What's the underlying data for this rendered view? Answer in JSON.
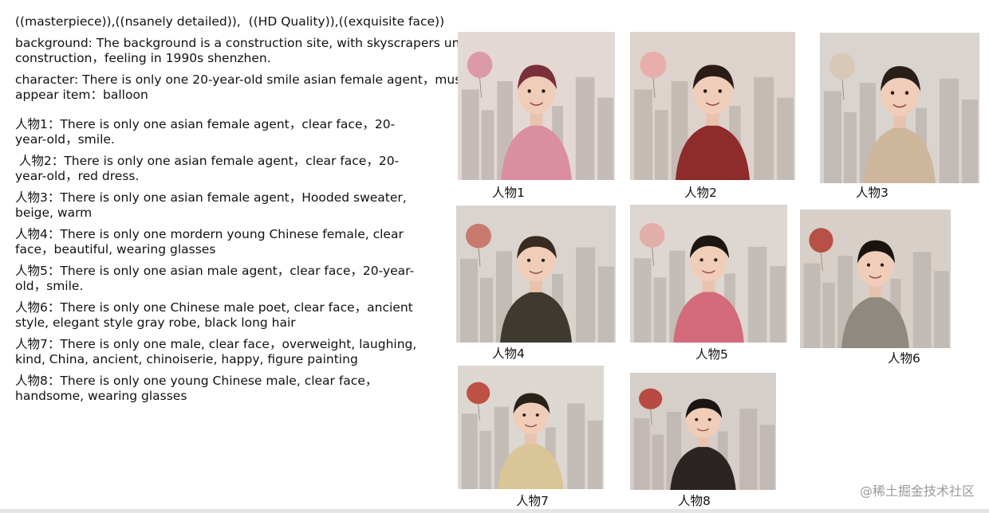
{
  "prompt_text": {
    "quality_line": "((masterpiece)),((nsanely detailed)),  ((HD Quality)),((exquisite face))",
    "background_lines": [
      "background: The background is a construction site, with skyscrapers under",
      "construction，feeling in 1990s shenzhen."
    ],
    "character_lines": [
      "character: There is only one 20-year-old smile asian female agent，must",
      "appear item：balloon"
    ],
    "character_list": [
      {
        "lines": [
          "人物1：There is only one asian female agent，clear face，20-",
          "year-old，smile."
        ]
      },
      {
        "lines": [
          " 人物2：There is only one asian female agent，clear face，20-",
          "year-old，red dress."
        ]
      },
      {
        "lines": [
          "人物3：There is only one asian female agent，Hooded sweater,",
          "beige, warm"
        ]
      },
      {
        "lines": [
          "人物4：There is only one mordern young Chinese female, clear",
          "face，beautiful, wearing glasses"
        ]
      },
      {
        "lines": [
          "人物5：There is only one asian male agent，clear face，20-year-",
          "old，smile."
        ]
      },
      {
        "lines": [
          "人物6：There is only one Chinese male poet, clear face，ancient",
          "style, elegant style gray robe, black long hair"
        ]
      },
      {
        "lines": [
          "人物7：There is only one male, clear face，overweight, laughing,",
          "kind, China, ancient, chinoiserie, happy, figure painting"
        ]
      },
      {
        "lines": [
          "人物8：There is only one young Chinese male, clear face，",
          "handsome, wearing glasses"
        ]
      }
    ]
  },
  "gallery": [
    {
      "caption": "人物1",
      "icon": "portrait-smiling-woman-balloon",
      "colors": {
        "bg": "#e4d8d4",
        "accent": "#d98fa0",
        "hair": "#7a2f3a",
        "cloth": "#d98fa0"
      }
    },
    {
      "caption": "人物2",
      "icon": "portrait-woman-red-dress",
      "colors": {
        "bg": "#ddd3cc",
        "accent": "#e9a7a6",
        "hair": "#2b1c18",
        "cloth": "#8e2b2b"
      }
    },
    {
      "caption": "人物3",
      "icon": "portrait-woman-hooded-sweater",
      "colors": {
        "bg": "#d9d4cf",
        "accent": "#d9c6b1",
        "hair": "#2a1e18",
        "cloth": "#cdb69c"
      }
    },
    {
      "caption": "人物4",
      "icon": "portrait-woman-glasses",
      "colors": {
        "bg": "#dad4cf",
        "accent": "#c46a5a",
        "hair": "#3b2a22",
        "cloth": "#3e3a2f"
      }
    },
    {
      "caption": "人物5",
      "icon": "portrait-man-pink-jacket",
      "colors": {
        "bg": "#ddd6d1",
        "accent": "#e2a7a2",
        "hair": "#1c1612",
        "cloth": "#d36b7a"
      }
    },
    {
      "caption": "人物6",
      "icon": "portrait-man-gray-robe",
      "colors": {
        "bg": "#d8d0c8",
        "accent": "#b23a2e",
        "hair": "#1a1410",
        "cloth": "#8f8a80"
      }
    },
    {
      "caption": "人物7",
      "icon": "portrait-laughing-man",
      "colors": {
        "bg": "#ddd7d1",
        "accent": "#b83a2e",
        "hair": "#2a201a",
        "cloth": "#d9c596"
      }
    },
    {
      "caption": "人物8",
      "icon": "portrait-man-glasses",
      "colors": {
        "bg": "#d6cec8",
        "accent": "#b2322a",
        "hair": "#1a1512",
        "cloth": "#2a2422"
      }
    }
  ],
  "watermark": "@稀土掘金技术社区"
}
